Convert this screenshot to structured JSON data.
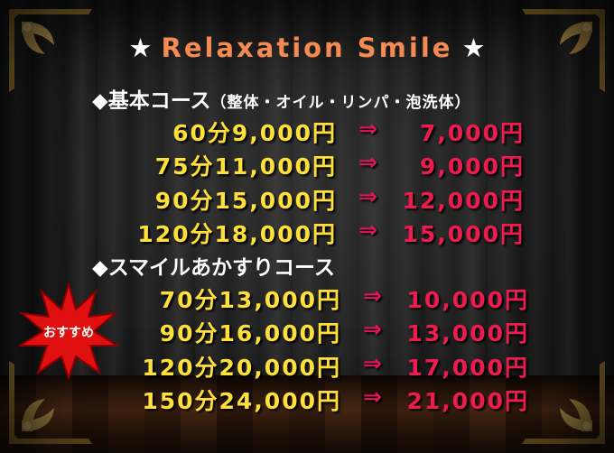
{
  "header": {
    "star_left": "★",
    "title": "Relaxation Smile",
    "star_right": "★"
  },
  "course_basic": {
    "heading": "◆基本コース",
    "subheading": "（整体・オイル・リンパ・泡洗体）",
    "rows": [
      {
        "duration": "60分",
        "price_old": "9,000円",
        "arrow": "⇒",
        "price_new": "7,000円"
      },
      {
        "duration": "75分",
        "price_old": "11,000円",
        "arrow": "⇒",
        "price_new": "9,000円"
      },
      {
        "duration": "90分",
        "price_old": "15,000円",
        "arrow": "⇒",
        "price_new": "12,000円"
      },
      {
        "duration": "120分",
        "price_old": "18,000円",
        "arrow": "⇒",
        "price_new": "15,000円"
      }
    ]
  },
  "course_smile": {
    "heading": "◆スマイルあかすりコース",
    "rows": [
      {
        "duration": "70分",
        "price_old": "13,000円",
        "arrow": "⇒",
        "price_new": "10,000円"
      },
      {
        "duration": "90分",
        "price_old": "16,000円",
        "arrow": "⇒",
        "price_new": "13,000円"
      },
      {
        "duration": "120分",
        "price_old": "20,000円",
        "arrow": "⇒",
        "price_new": "17,000円"
      },
      {
        "duration": "150分",
        "price_old": "24,000円",
        "arrow": "⇒",
        "price_new": "21,000円"
      }
    ]
  },
  "badge": {
    "label": "おすすめ",
    "color": "#e01010"
  },
  "colors": {
    "title": "#f28a52",
    "old_price": "#ffe03a",
    "new_price": "#ee1c4e",
    "arrow": "#e8145a"
  }
}
